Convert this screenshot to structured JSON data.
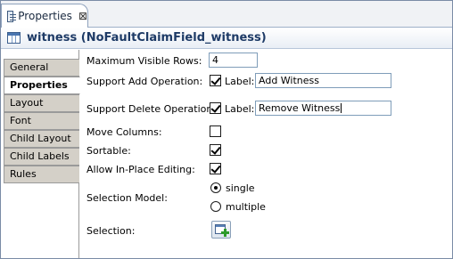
{
  "tab": {
    "title": "Properties",
    "close": "⊠"
  },
  "header": {
    "title": "witness (NoFaultClaimField_witness)"
  },
  "sidebar": {
    "items": [
      {
        "label": "General"
      },
      {
        "label": "Properties",
        "active": true
      },
      {
        "label": "Layout"
      },
      {
        "label": "Font"
      },
      {
        "label": "Child Layout"
      },
      {
        "label": "Child Labels"
      },
      {
        "label": "Rules"
      }
    ]
  },
  "form": {
    "max_rows": {
      "label": "Maximum Visible Rows:",
      "value": "4"
    },
    "add_op": {
      "label": "Support Add Operation:",
      "checked": true,
      "sub_label": "Label:",
      "value": "Add Witness"
    },
    "delete_op": {
      "label": "Support Delete Operation:",
      "checked": true,
      "sub_label": "Label:",
      "value": "Remove Witness"
    },
    "move_columns": {
      "label": "Move Columns:",
      "checked": false
    },
    "sortable": {
      "label": "Sortable:",
      "checked": true
    },
    "inplace": {
      "label": "Allow In-Place Editing:",
      "checked": true
    },
    "selection_model": {
      "label": "Selection Model:",
      "options": [
        "single",
        "multiple"
      ],
      "selected": "single"
    },
    "selection": {
      "label": "Selection:"
    }
  },
  "colors": {
    "header_text": "#1d3a66",
    "sidebar_bg": "#d4d0c8",
    "border": "#7f9db9"
  }
}
